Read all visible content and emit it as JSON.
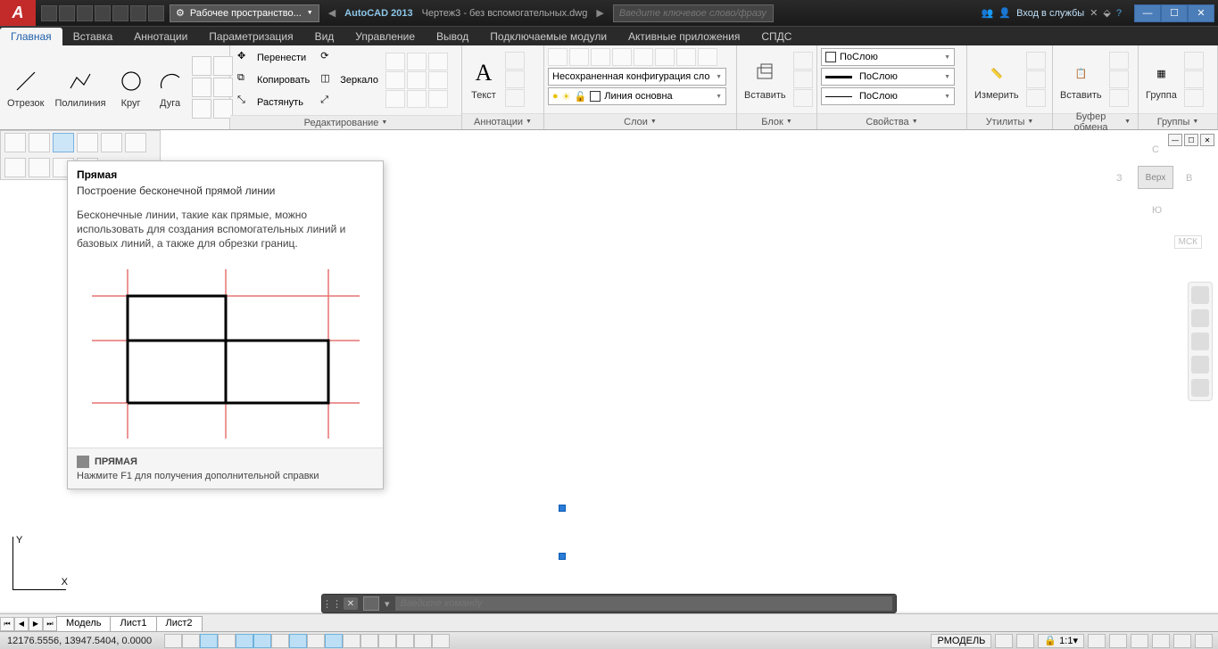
{
  "title": {
    "app": "AutoCAD 2013",
    "file": "Чертеж3 - без вспомогательных.dwg"
  },
  "workspace": "Рабочее пространство...",
  "search_placeholder": "Введите ключевое слово/фразу",
  "signin": "Вход в службы",
  "menu": {
    "home": "Главная",
    "insert": "Вставка",
    "annotate": "Аннотации",
    "param": "Параметризация",
    "view": "Вид",
    "manage": "Управление",
    "output": "Вывод",
    "plugins": "Подключаемые модули",
    "activeapps": "Активные приложения",
    "spds": "СПДС"
  },
  "ribbon": {
    "draw": {
      "line": "Отрезок",
      "pline": "Полилиния",
      "circle": "Круг",
      "arc": "Дуга"
    },
    "modify": {
      "move": "Перенести",
      "copy": "Копировать",
      "stretch": "Растянуть",
      "mirror": "Зеркало",
      "title": "Редактирование"
    },
    "text": {
      "text": "Текст",
      "title": "Аннотации"
    },
    "layers": {
      "combo": "Несохраненная конфигурация сло",
      "current": "Линия основна",
      "title": "Слои"
    },
    "block": {
      "insert": "Вставить",
      "title": "Блок"
    },
    "props": {
      "bylayer": "ПоСлою",
      "bylayer2": "ПоСлою",
      "bylayer3": "ПоСлою",
      "title": "Свойства"
    },
    "utils": {
      "measure": "Измерить",
      "title": "Утилиты"
    },
    "clip": {
      "paste": "Вставить",
      "title": "Буфер обмена"
    },
    "group": {
      "group": "Группа",
      "title": "Группы"
    }
  },
  "tooltip": {
    "title": "Прямая",
    "sub": "Построение бесконечной прямой линии",
    "desc": "Бесконечные линии, такие как прямые, можно использовать для создания вспомогательных линий и базовых линий, а также для обрезки границ.",
    "cmd": "ПРЯМАЯ",
    "help": "Нажмите F1 для получения дополнительной справки"
  },
  "viewcube": {
    "top": "Верх",
    "n": "С",
    "s": "Ю",
    "e": "В",
    "w": "З",
    "ucs": "МСК"
  },
  "cmd_placeholder": "Введите команду",
  "tabs": {
    "model": "Модель",
    "sheet1": "Лист1",
    "sheet2": "Лист2"
  },
  "status": {
    "coords": "12176.5556, 13947.5404, 0.0000",
    "pmodel": "РМОДЕЛЬ",
    "scale": "1:1"
  }
}
